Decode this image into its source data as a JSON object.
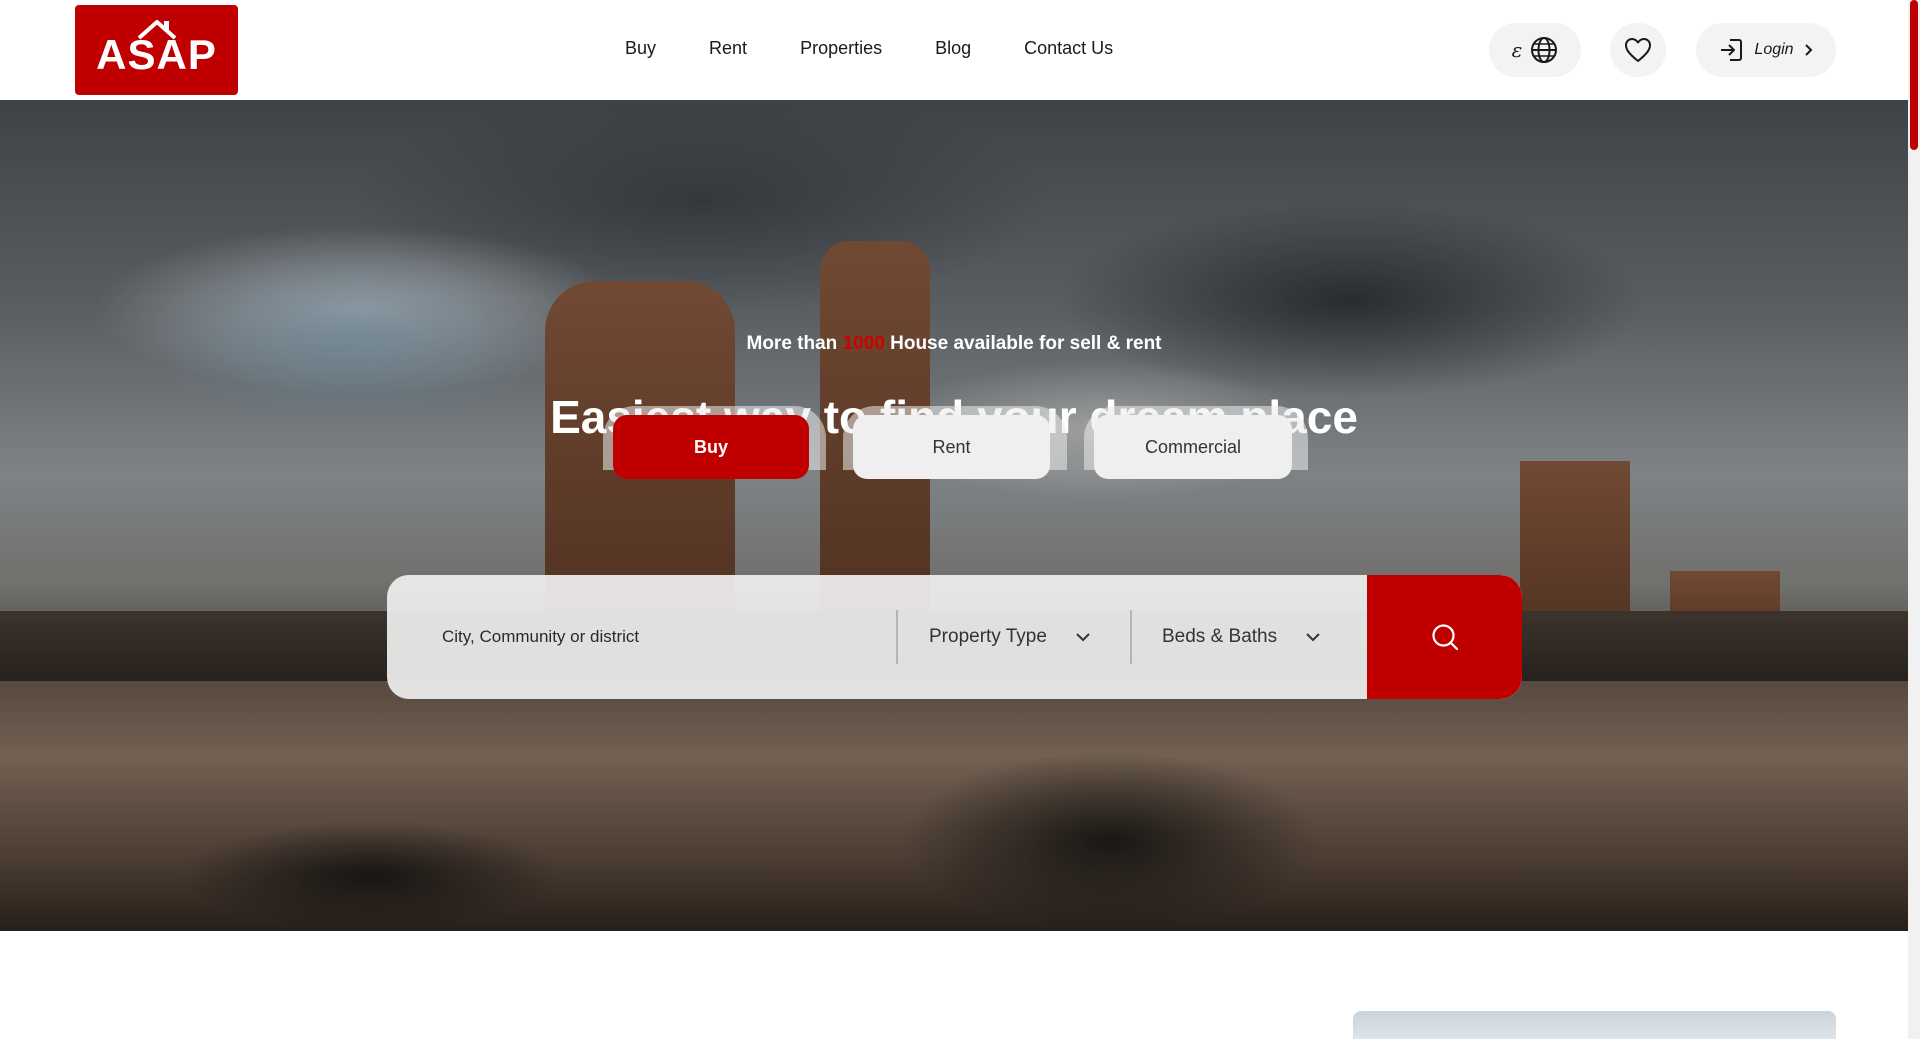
{
  "header": {
    "logo_text": "ASAP",
    "nav": [
      "Buy",
      "Rent",
      "Properties",
      "Blog",
      "Contact Us"
    ],
    "currency_symbol": "ε",
    "login_label": "Login"
  },
  "hero": {
    "subtitle_prefix": "More than",
    "subtitle_count": "1000",
    "subtitle_suffix": "House available for sell & rent",
    "title": "Easiest way to find your dream place"
  },
  "search": {
    "tabs": [
      "Buy",
      "Rent",
      "Commercial"
    ],
    "active_tab": "Buy",
    "location_placeholder": "City, Community or district",
    "property_type_label": "Property Type",
    "beds_baths_label": "Beds & Baths"
  },
  "colors": {
    "brand_red": "#c00000",
    "pill_bg": "#f3f3f3"
  },
  "icons": {
    "language": "globe-icon",
    "favorites": "heart-icon",
    "login": "login-arrow-icon",
    "chevron": "chevron-down-icon",
    "search": "search-icon"
  }
}
